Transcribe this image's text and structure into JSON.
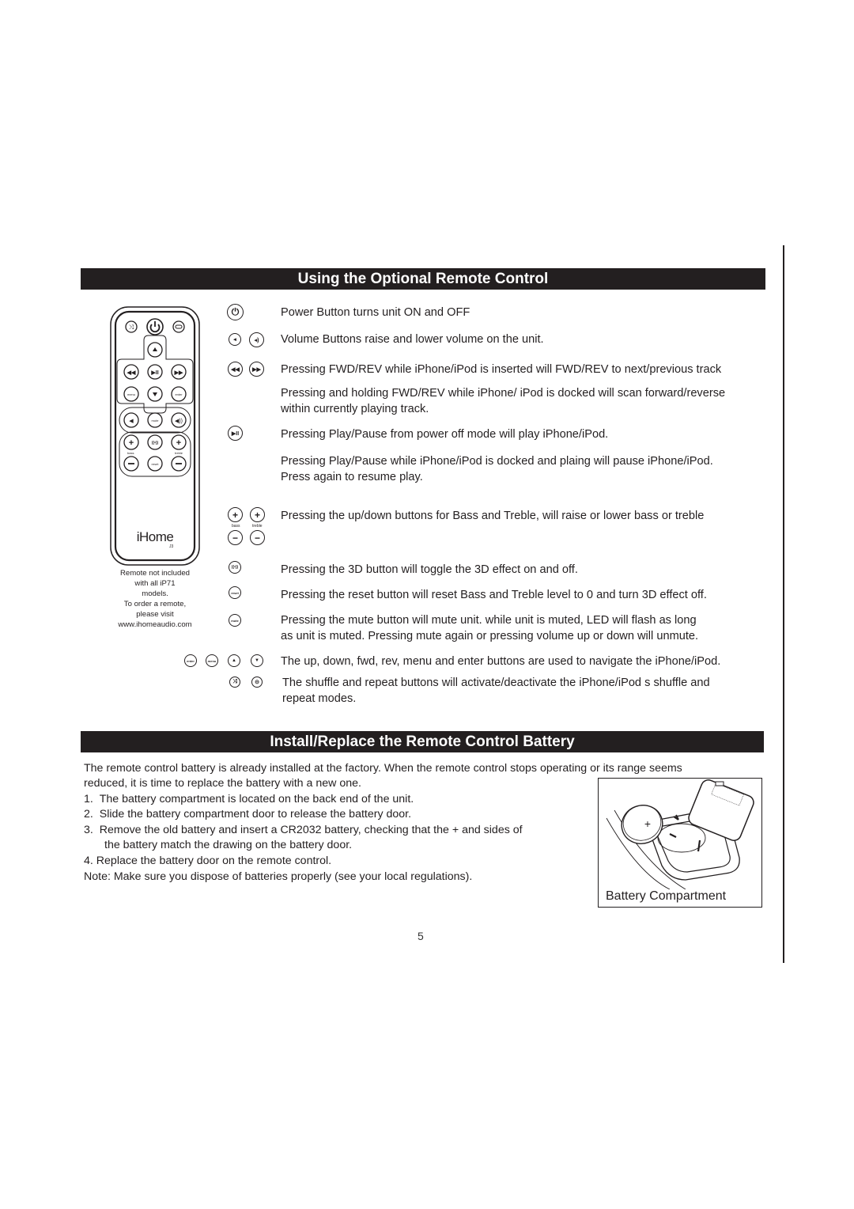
{
  "section1": {
    "title": "Using the Optional Remote Control",
    "remote": {
      "brand": "iHome",
      "model": "J3",
      "button_labels": {
        "menu": "menu",
        "enter": "enter",
        "mute": "mute",
        "bass": "bass",
        "treble": "treble",
        "reset": "reset"
      }
    },
    "remote_note": [
      "Remote not included",
      "with all iP71",
      "models.",
      "To order a remote,",
      "please visit",
      "www.ihomeaudio.com"
    ],
    "items": [
      {
        "icons": [
          "power-icon"
        ],
        "lines": [
          "Power Button turns unit ON and OFF"
        ]
      },
      {
        "icons": [
          "volume-down-icon",
          "volume-up-icon"
        ],
        "lines": [
          "Volume Buttons raise and lower volume on the unit."
        ]
      },
      {
        "icons": [
          "rewind-icon",
          "fast-forward-icon"
        ],
        "lines": [
          "Pressing FWD/REV while iPhone/iPod is inserted will FWD/REV to next/previous track"
        ]
      },
      {
        "icons": [],
        "lines": [
          "Pressing and holding FWD/REV while iPhone/ iPod is docked will scan forward/reverse",
          "within currently playing track."
        ]
      },
      {
        "icons": [
          "play-pause-icon"
        ],
        "lines": [
          "Pressing Play/Pause from power off mode will play iPhone/iPod."
        ]
      },
      {
        "icons": [],
        "lines": [
          "Pressing Play/Pause while iPhone/iPod is docked and plaing will pause iPhone/iPod.",
          "Press again to resume play."
        ]
      },
      {
        "icons": [
          "bass-plus-icon",
          "treble-plus-icon",
          "bass-minus-icon",
          "treble-minus-icon"
        ],
        "lines": [
          "Pressing the up/down buttons for Bass and Treble, will raise or lower bass or treble"
        ]
      },
      {
        "icons": [
          "3d-icon"
        ],
        "lines": [
          "Pressing the 3D button will toggle the 3D effect on  and off."
        ]
      },
      {
        "icons": [
          "reset-icon"
        ],
        "lines": [
          "Pressing the reset button will reset Bass and Treble level to 0 and turn 3D effect off."
        ]
      },
      {
        "icons": [
          "mute-icon"
        ],
        "lines": [
          "Pressing the mute button will mute unit. while unit is muted, LED will flash as long",
          "as unit is muted. Pressing mute again or pressing volume up or down will unmute."
        ]
      },
      {
        "icons": [
          "enter-icon",
          "menu-icon",
          "up-icon",
          "down-icon"
        ],
        "lines": [
          "The up, down, fwd, rev, menu and enter buttons are used to navigate the iPhone/iPod."
        ]
      },
      {
        "icons": [
          "shuffle-icon",
          "repeat-icon"
        ],
        "lines": [
          "The shuffle and repeat buttons will activate/deactivate the iPhone/iPod s shuffle and",
          "repeat modes."
        ]
      }
    ]
  },
  "section2": {
    "title": "Install/Replace the Remote Control Battery",
    "intro": [
      "The remote control battery is already installed at the factory. When the remote control stops operating or its range seems",
      "reduced, it is time to replace the battery with a new one."
    ],
    "steps": [
      {
        "num": "1.",
        "lines": [
          "The battery compartment is located on the back end of the unit."
        ]
      },
      {
        "num": "2.",
        "lines": [
          "Slide the battery compartment door to release the battery door."
        ]
      },
      {
        "num": "3.",
        "lines": [
          "Remove the old battery and insert a CR2032 battery, checking that the + and   sides of",
          "the battery match the drawing on the battery door."
        ]
      },
      {
        "num": "4.",
        "lines": [
          "Replace the battery door on the remote control."
        ]
      }
    ],
    "note": "Note:  Make sure you dispose of batteries properly (see your local regulations).",
    "figure_caption": "Battery Compartment",
    "battery_plus": "+"
  },
  "page_number": "5"
}
